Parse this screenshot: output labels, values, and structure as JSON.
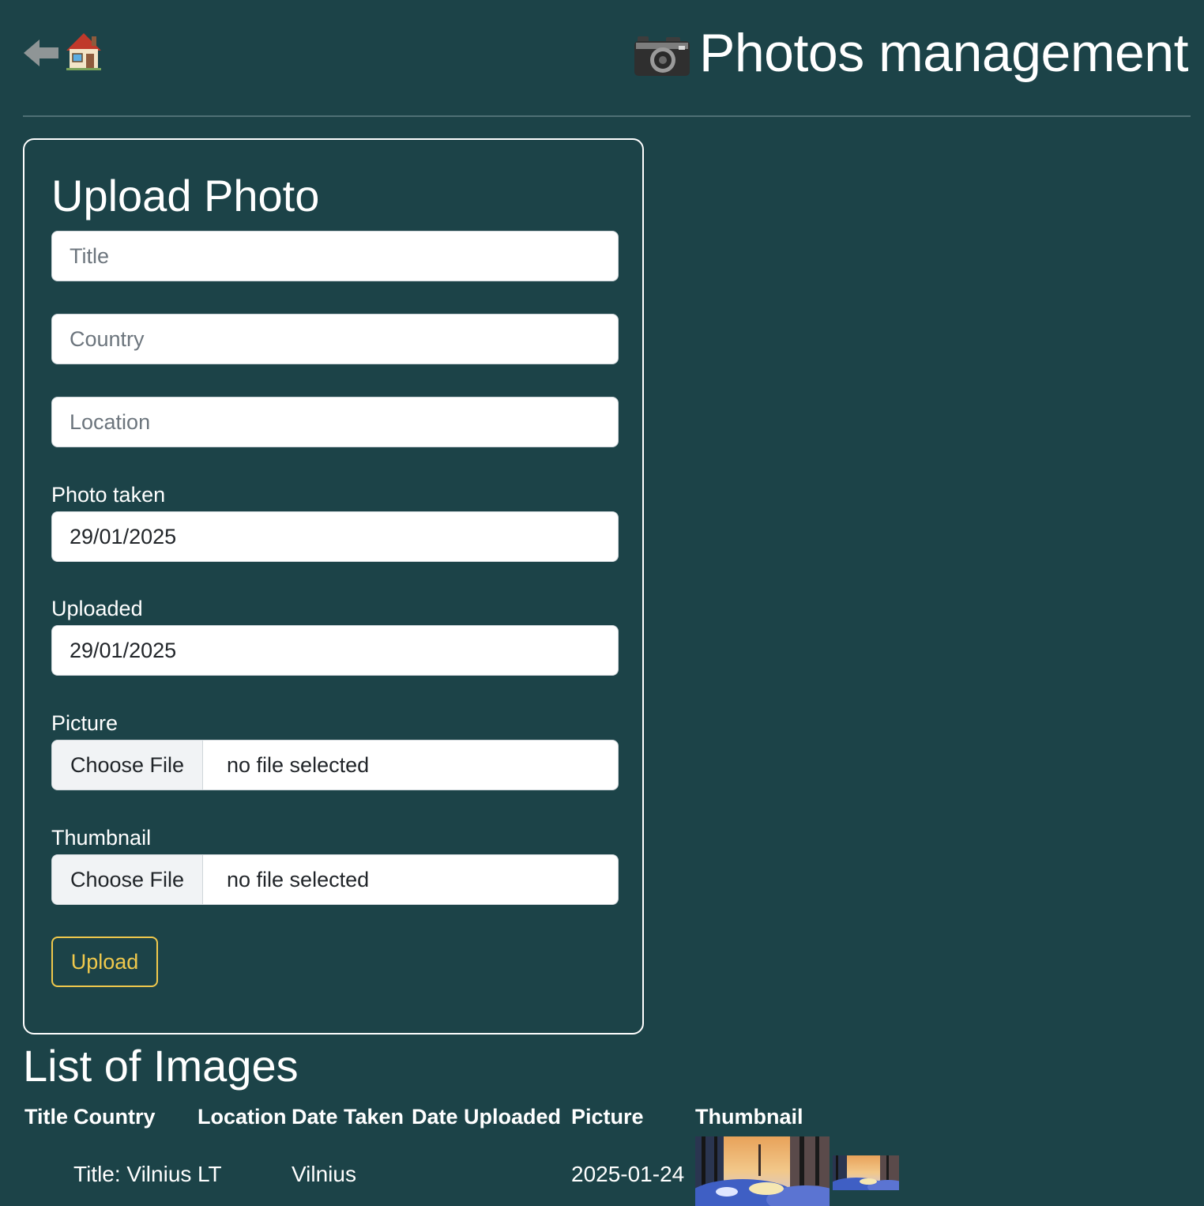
{
  "header": {
    "title": "Photos management",
    "icons": {
      "back": "back-arrow-icon",
      "home": "house-icon",
      "title": "camera-icon"
    }
  },
  "form": {
    "title": "Upload Photo",
    "title_placeholder": "Title",
    "country_placeholder": "Country",
    "location_placeholder": "Location",
    "photo_taken_label": "Photo taken",
    "photo_taken_value": "29/01/2025",
    "uploaded_label": "Uploaded",
    "uploaded_value": "29/01/2025",
    "picture_label": "Picture",
    "thumbnail_label": "Thumbnail",
    "choose_file_label": "Choose File",
    "no_file_text": "no file selected",
    "upload_button": "Upload"
  },
  "list": {
    "title": "List of Images",
    "columns": [
      "Title",
      "Country",
      "Location",
      "Date Taken",
      "Date Uploaded",
      "Picture",
      "Thumbnail"
    ],
    "rows": [
      {
        "title": "Title: Vilnius",
        "country": "LT",
        "location": "Vilnius",
        "date_taken": "",
        "date_uploaded": "2025-01-24"
      }
    ]
  },
  "colors": {
    "background": "#1c4348",
    "text": "#ffffff",
    "accent": "#f0c94c",
    "input_border": "#cfd6da"
  }
}
